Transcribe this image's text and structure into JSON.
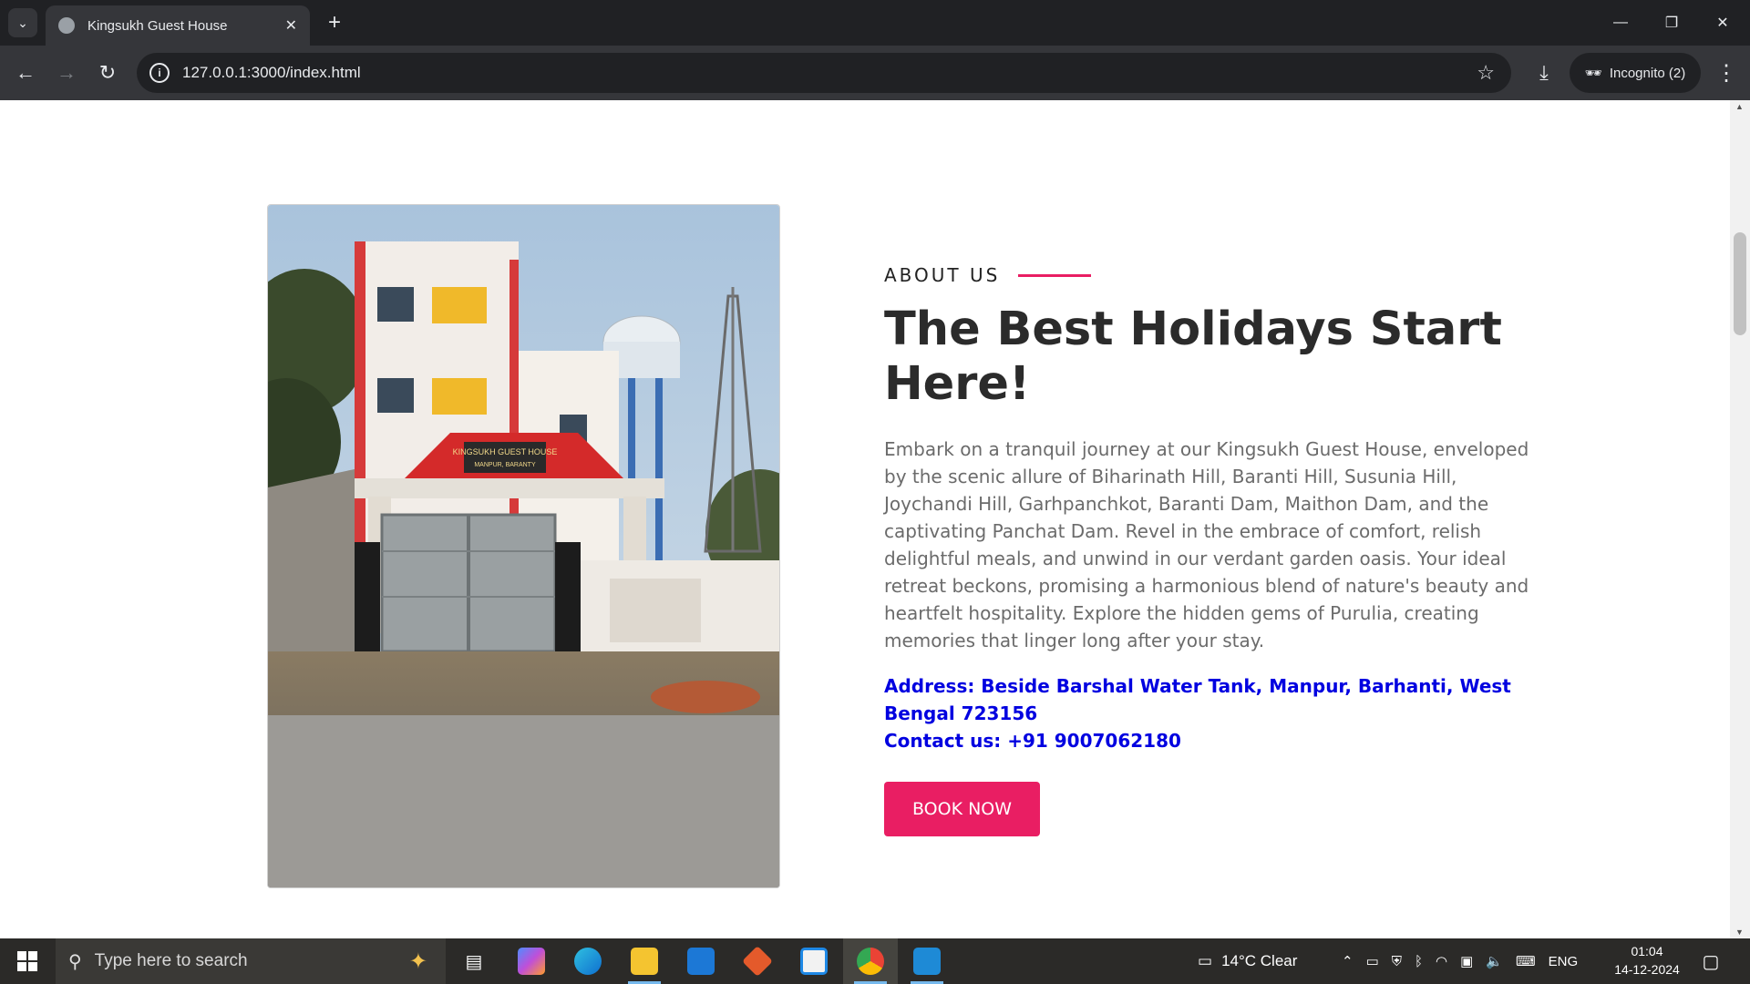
{
  "browser": {
    "tab_title": "Kingsukh Guest House",
    "url": "127.0.0.1:3000/index.html",
    "incognito_label": "Incognito (2)"
  },
  "about": {
    "eyebrow": "ABOUT US",
    "heading": "The Best Holidays Start Here!",
    "description": "Embark on a tranquil journey at our Kingsukh Guest House, enveloped by the scenic allure of Biharinath Hill, Baranti Hill, Susunia Hill, Joychandi Hill, Garhpanchkot, Baranti Dam, Maithon Dam, and the captivating Panchat Dam. Revel in the embrace of comfort, relish delightful meals, and unwind in our verdant garden oasis. Your ideal retreat beckons, promising a harmonious blend of nature's beauty and heartfelt hospitality. Explore the hidden gems of Purulia, creating memories that linger long after your stay.",
    "address": "Address: Beside Barshal Water Tank, Manpur, Barhanti, West Bengal 723156",
    "contact": "Contact us: +91 9007062180",
    "button_label": "BOOK NOW",
    "sign_line1": "KINGSUKH GUEST HOUSE",
    "sign_line2": "MANPUR, BARANTY",
    "accent_color": "#e91e63",
    "link_color": "#0000e0"
  },
  "taskbar": {
    "search_placeholder": "Type here to search",
    "weather": "14°C  Clear",
    "language": "ENG",
    "time": "01:04",
    "date": "14-12-2024"
  }
}
